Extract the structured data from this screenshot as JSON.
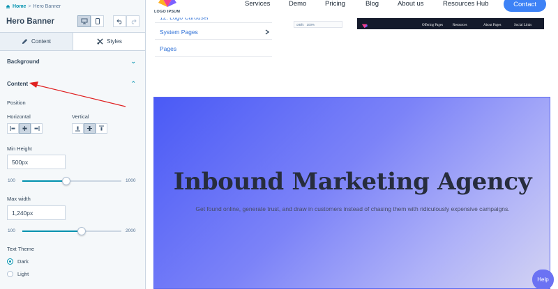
{
  "breadcrumb": {
    "home": "Home",
    "separator": ">",
    "current": "Hero Banner"
  },
  "panel": {
    "title": "Hero Banner"
  },
  "tabs": [
    {
      "label": "Content",
      "icon": "pencil-icon"
    },
    {
      "label": "Styles",
      "icon": "brush-icon"
    }
  ],
  "sections": {
    "background": "Background",
    "content": "Content"
  },
  "position": {
    "label": "Position",
    "horizontal_label": "Horizontal",
    "vertical_label": "Vertical",
    "horizontal_selected": "center",
    "vertical_selected": "middle"
  },
  "min_height": {
    "label": "Min Height",
    "value": "500px",
    "min": "100",
    "max": "1000",
    "current": 500
  },
  "max_width": {
    "label": "Max width",
    "value": "1,240px",
    "min": "100",
    "max": "2000",
    "current": 1240
  },
  "text_theme": {
    "label": "Text Theme",
    "options": [
      "Dark",
      "Light"
    ],
    "selected": "Dark"
  },
  "site": {
    "logo_text": "LOGO IPSUM",
    "nav": [
      "Services",
      "Demo",
      "Pricing",
      "Blog",
      "About us",
      "Resources Hub"
    ],
    "contact": "Contact",
    "menu": [
      "12. Logo Carousel",
      "System Pages",
      "Pages"
    ],
    "mini_toolbar": {
      "a": "orBfs",
      "b": "100%"
    },
    "dark_bar_links": [
      "Offering Pages",
      "Resources",
      "About Pages",
      "Social Links"
    ]
  },
  "hero": {
    "title": "Inbound Marketing Agency",
    "subtitle": "Get found online, generate trust, and draw in customers instead of chasing them with ridiculously expensive campaigns."
  },
  "help": "Help",
  "colors": {
    "accent": "#0091ae",
    "contact": "#3d82f6",
    "arrow": "#e02020",
    "hero_start": "#4a5af6",
    "hero_end": "#d3d3f3"
  }
}
